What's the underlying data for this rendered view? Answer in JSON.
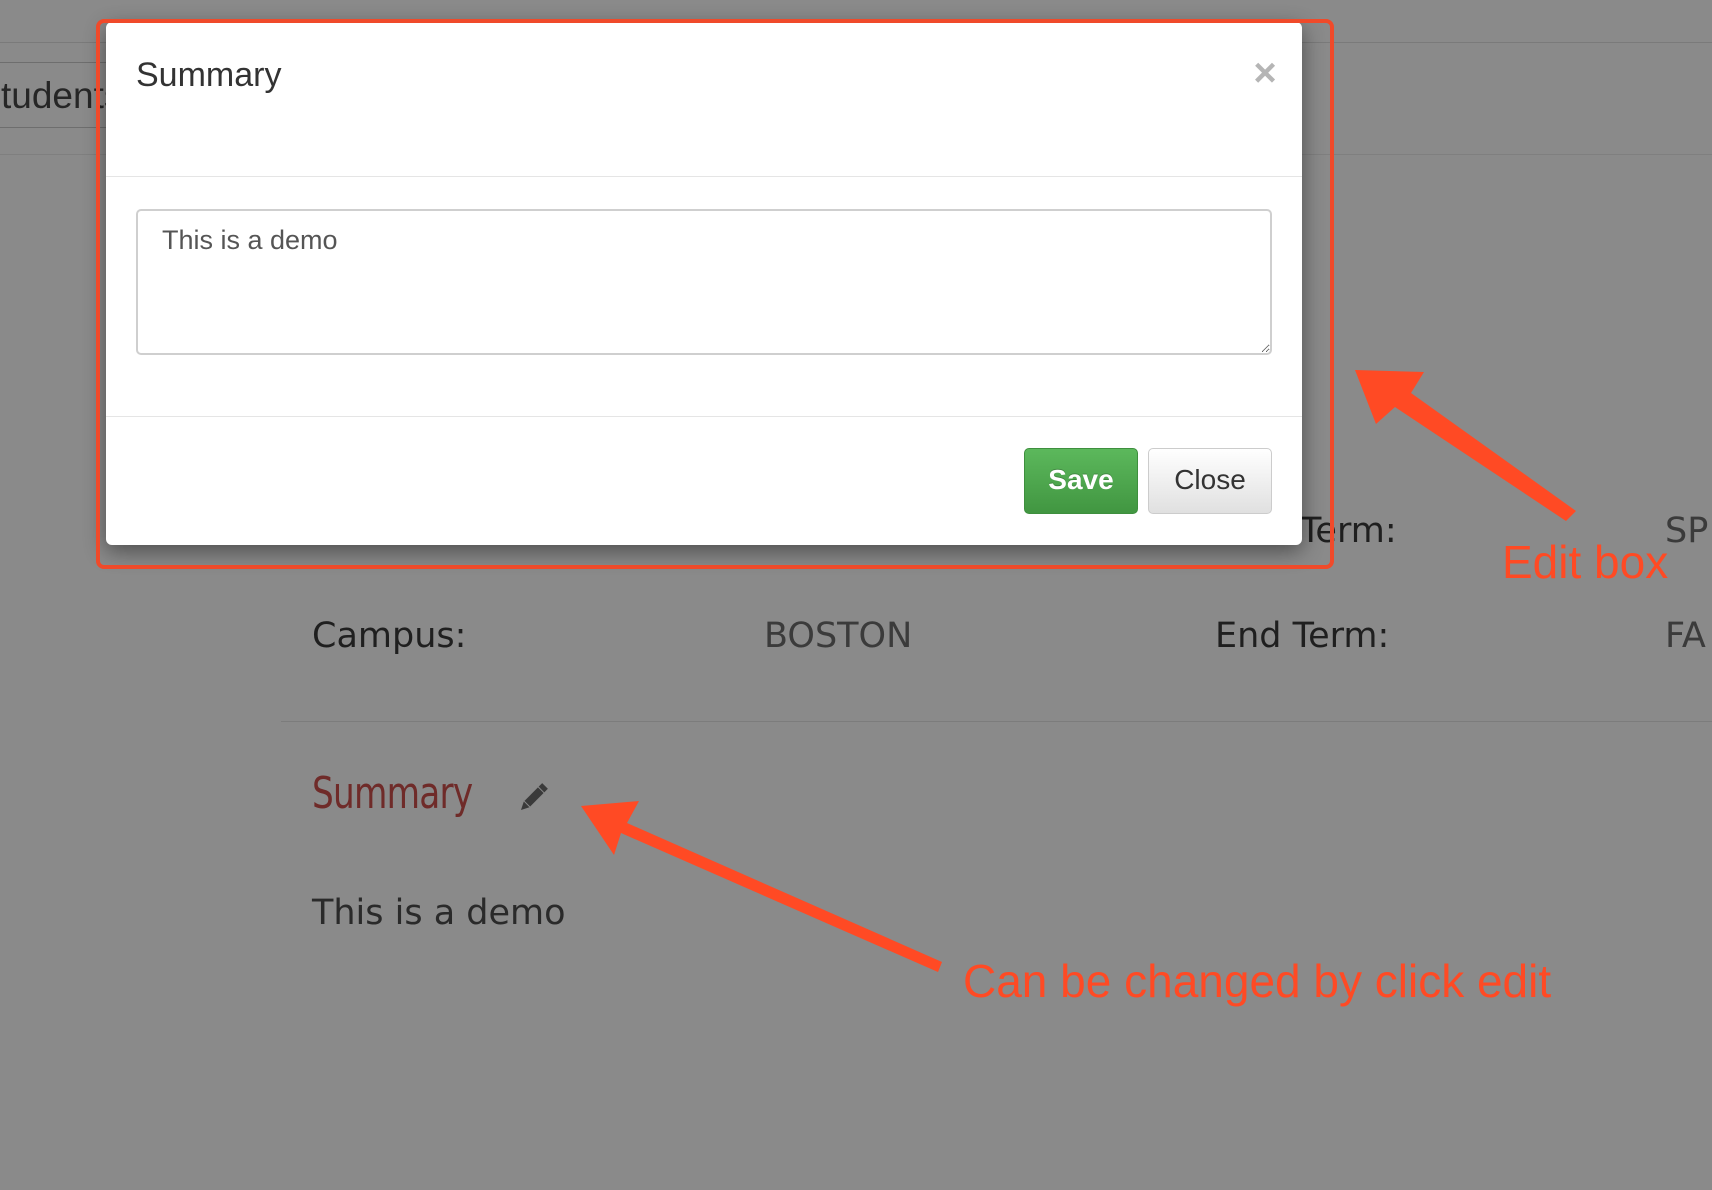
{
  "background_page": {
    "students_tab_label": "tudents",
    "fields": {
      "term_label": "Term:",
      "term_value": "SP",
      "campus_label": "Campus:",
      "campus_value": "BOSTON",
      "end_term_label": "End Term:",
      "end_term_value": "FA"
    },
    "summary_section": {
      "heading": "Summary",
      "edit_icon": "pencil-icon",
      "text": "This is a demo"
    }
  },
  "modal": {
    "title": "Summary",
    "close_icon": "close-icon",
    "close_symbol": "×",
    "textarea_value": "This is a demo",
    "save_label": "Save",
    "close_label": "Close"
  },
  "annotations": {
    "edit_box_label": "Edit box",
    "edit_hint_label": "Can be changed by click edit",
    "color": "#ff4a24"
  },
  "colors": {
    "overlay": "#8a8a8a",
    "save_button": "#4cae4c",
    "summary_heading": "#6f2b29"
  }
}
